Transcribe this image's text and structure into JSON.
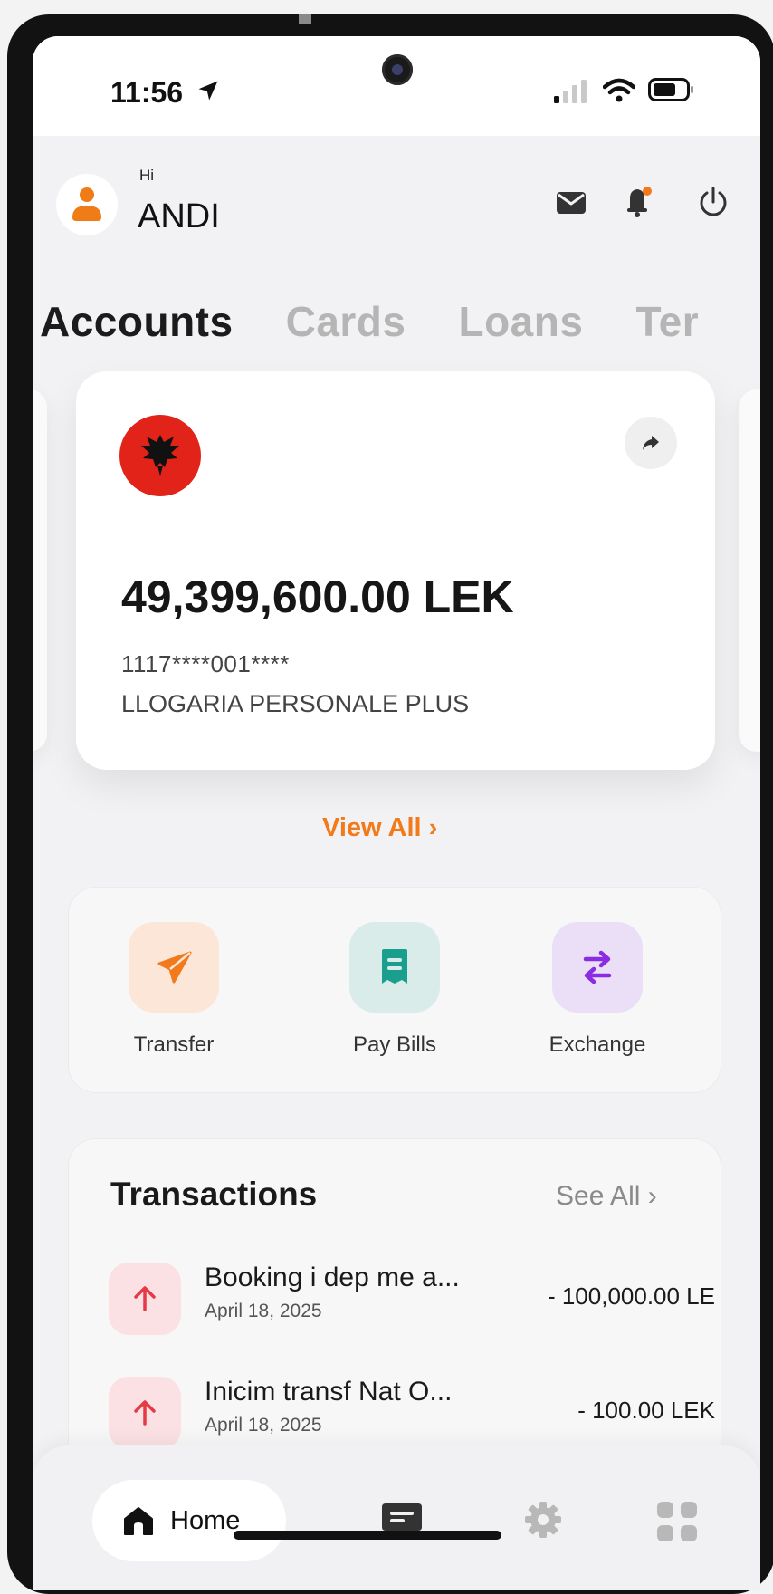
{
  "status_bar": {
    "time": "11:56"
  },
  "header": {
    "greeting": "Hi",
    "user_name": "ANDI"
  },
  "tabs": [
    {
      "label": "Accounts",
      "active": true
    },
    {
      "label": "Cards",
      "active": false
    },
    {
      "label": "Loans",
      "active": false
    },
    {
      "label": "Ter",
      "active": false
    }
  ],
  "account_card": {
    "balance": "49,399,600.00 LEK",
    "account_number": "1117****001****",
    "account_type": "LLOGARIA PERSONALE PLUS",
    "flag_icon": "albania-flag-icon"
  },
  "view_all": {
    "label": "View All ›"
  },
  "quick_actions": [
    {
      "label": "Transfer",
      "icon": "paper-plane-icon",
      "color": "#f27a1a"
    },
    {
      "label": "Pay Bills",
      "icon": "receipt-icon",
      "color": "#1a9f8e"
    },
    {
      "label": "Exchange",
      "icon": "swap-arrows-icon",
      "color": "#8b2be2"
    }
  ],
  "transactions": {
    "title": "Transactions",
    "see_all_label": "See All ›",
    "items": [
      {
        "name": "Booking i dep me a...",
        "date": "April 18, 2025",
        "amount": "- 100,000.00 LE"
      },
      {
        "name": "Inicim transf Nat O...",
        "date": "April 18, 2025",
        "amount": "- 100.00 LEK"
      }
    ]
  },
  "bottom_nav": {
    "home_label": "Home"
  },
  "colors": {
    "accent": "#f27a1a",
    "outgoing": "#e53945",
    "background": "#f2f2f4"
  }
}
